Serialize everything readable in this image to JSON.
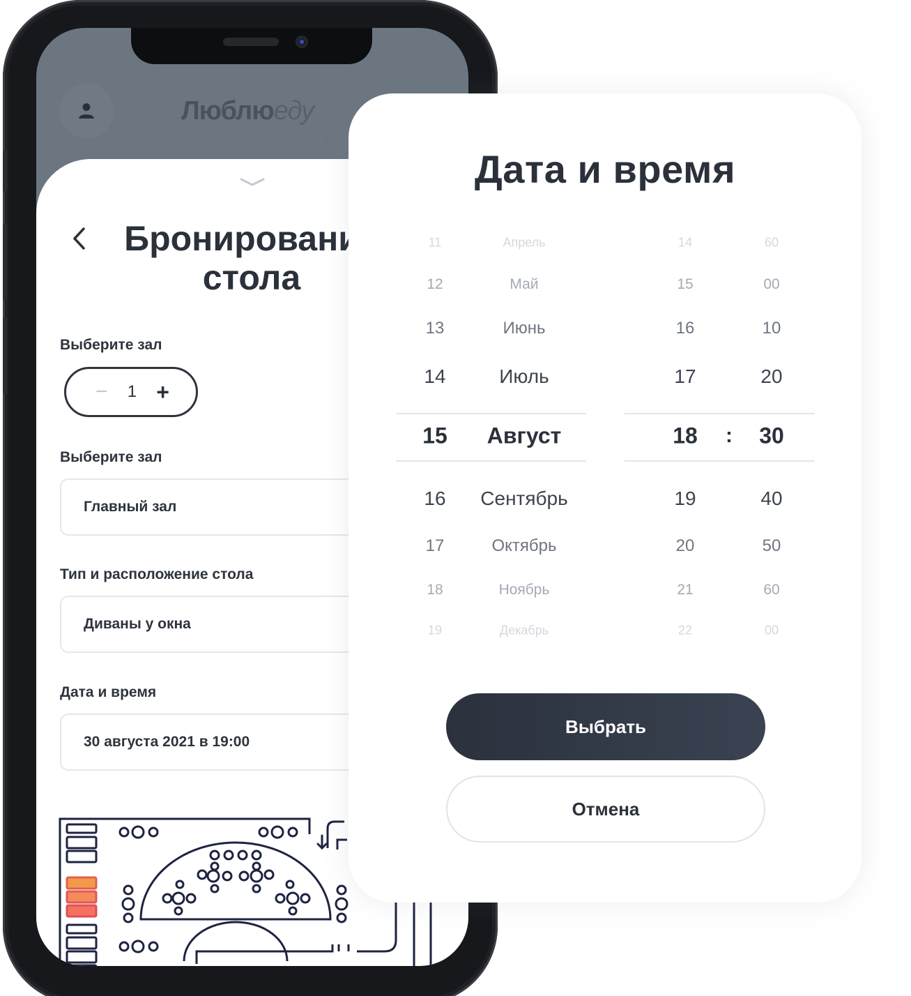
{
  "app": {
    "brand_bold": "Люблю",
    "brand_light": "еду"
  },
  "booking": {
    "title_line1": "Бронирование",
    "title_line2": "стола",
    "guests_label": "Выберите зал",
    "guests_minus": "−",
    "guests_value": "1",
    "guests_plus": "+",
    "hall_label": "Выберите зал",
    "hall_value": "Главный зал",
    "table_label": "Тип и расположение стола",
    "table_value": "Диваны у окна",
    "datetime_label": "Дата и время",
    "datetime_value": "30 августа 2021 в 19:00"
  },
  "picker": {
    "title": "Дата и время",
    "days": [
      "11",
      "12",
      "13",
      "14",
      "15",
      "16",
      "17",
      "18",
      "19"
    ],
    "months": [
      "Апрель",
      "Май",
      "Июнь",
      "Июль",
      "Август",
      "Сентябрь",
      "Октябрь",
      "Ноябрь",
      "Декабрь"
    ],
    "hours": [
      "14",
      "15",
      "16",
      "17",
      "18",
      "19",
      "20",
      "21",
      "22"
    ],
    "minutes": [
      "60",
      "00",
      "10",
      "20",
      "30",
      "40",
      "50",
      "60",
      "00"
    ],
    "selected_index": 4,
    "separator": ":",
    "confirm_label": "Выбрать",
    "cancel_label": "Отмена"
  },
  "colors": {
    "primary": "#2b313d",
    "text": "#2b313b",
    "highlight": "#f07a4f"
  }
}
